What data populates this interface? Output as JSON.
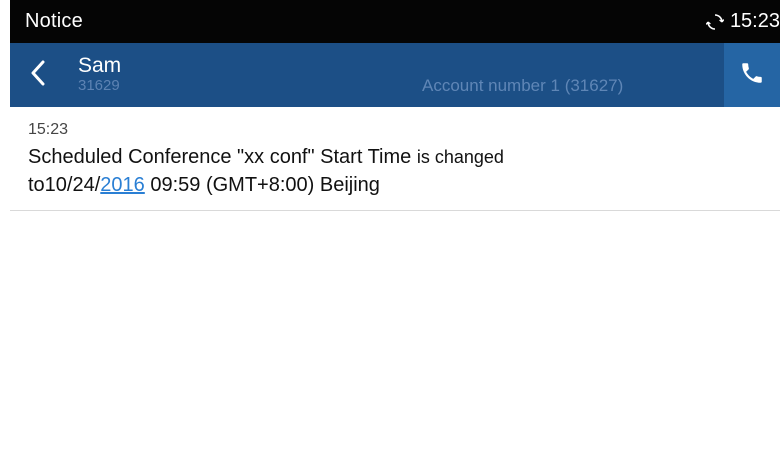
{
  "status_bar": {
    "title": "Notice",
    "time": "15:23",
    "sync_icon": "sync-icon"
  },
  "header": {
    "contact_name": "Sam",
    "contact_number": "31629",
    "account": "Account number 1 (31627)",
    "back_icon": "chevron-left-icon",
    "call_icon": "phone-icon"
  },
  "message": {
    "time": "15:23",
    "line1_part1": "Scheduled Conference \"xx conf\" Start Time",
    "line1_part2": "is changed",
    "line2_prefix": "to10/24/",
    "line2_link": "2016",
    "line2_suffix": " 09:59 (GMT+8:00) Beijing"
  },
  "colors": {
    "status_bar_bg": "#050505",
    "header_bg": "#1c4f86",
    "call_button_bg": "#2565a4",
    "link": "#2a7fd4"
  }
}
